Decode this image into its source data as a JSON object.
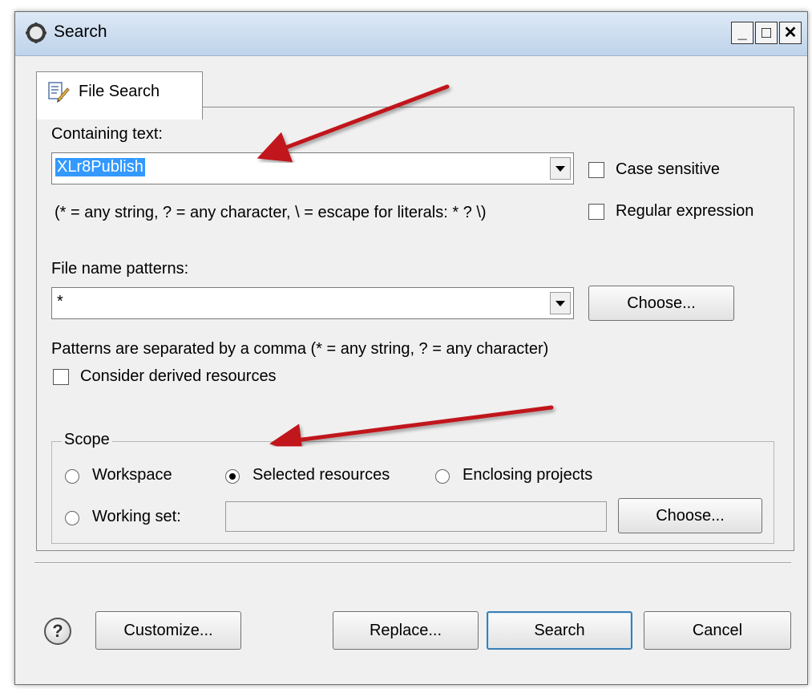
{
  "window": {
    "title": "Search",
    "controls": {
      "minimize": "_",
      "maximize": "□",
      "close": "✕"
    }
  },
  "tab": {
    "label": "File Search",
    "icon": "file-search-icon"
  },
  "containing_text": {
    "label": "Containing text:",
    "value": "XLr8Publish",
    "hint": "(* = any string, ? = any character, \\ = escape for literals: * ? \\)",
    "case_sensitive_label": "Case sensitive",
    "regex_label": "Regular expression"
  },
  "file_patterns": {
    "label": "File name patterns:",
    "value": "*",
    "choose_label": "Choose...",
    "hint": "Patterns are separated by a comma (* = any string, ? = any character)",
    "derived_label": "Consider derived resources"
  },
  "scope": {
    "legend": "Scope",
    "workspace": "Workspace",
    "selected": "Selected resources",
    "enclosing": "Enclosing projects",
    "working_set": "Working set:",
    "working_set_value": "",
    "choose_label": "Choose..."
  },
  "footer": {
    "help": "?",
    "customize": "Customize...",
    "replace": "Replace...",
    "search": "Search",
    "cancel": "Cancel"
  },
  "colors": {
    "annotation_arrow": "#c0161a",
    "selection": "#3399ff",
    "default_button_border": "#3c7fb1"
  }
}
